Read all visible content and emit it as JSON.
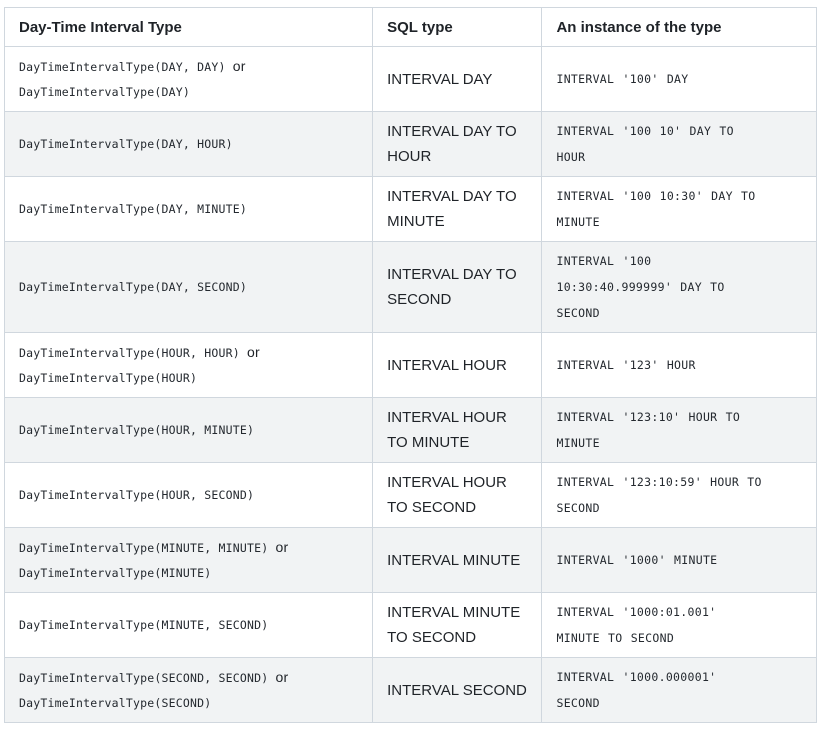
{
  "headers": {
    "col1": "Day-Time Interval Type",
    "col2": "SQL type",
    "col3": "An instance of the type"
  },
  "or_word": "or",
  "rows": [
    {
      "type_lines": [
        "DayTimeIntervalType(DAY, DAY)",
        "DayTimeIntervalType(DAY)"
      ],
      "sql_type_lines": [
        "INTERVAL DAY"
      ],
      "instance_lines": [
        "INTERVAL '100' DAY"
      ]
    },
    {
      "type_lines": [
        "DayTimeIntervalType(DAY, HOUR)"
      ],
      "sql_type_lines": [
        "INTERVAL DAY TO",
        "HOUR"
      ],
      "instance_lines": [
        "INTERVAL '100 10' DAY TO",
        "HOUR"
      ]
    },
    {
      "type_lines": [
        "DayTimeIntervalType(DAY, MINUTE)"
      ],
      "sql_type_lines": [
        "INTERVAL DAY TO",
        "MINUTE"
      ],
      "instance_lines": [
        "INTERVAL '100 10:30' DAY TO",
        "MINUTE"
      ]
    },
    {
      "type_lines": [
        "DayTimeIntervalType(DAY, SECOND)"
      ],
      "sql_type_lines": [
        "INTERVAL DAY TO",
        "SECOND"
      ],
      "instance_lines": [
        "INTERVAL '100",
        "10:30:40.999999' DAY TO",
        "SECOND"
      ]
    },
    {
      "type_lines": [
        "DayTimeIntervalType(HOUR, HOUR)",
        "DayTimeIntervalType(HOUR)"
      ],
      "sql_type_lines": [
        "INTERVAL HOUR"
      ],
      "instance_lines": [
        "INTERVAL '123' HOUR"
      ]
    },
    {
      "type_lines": [
        "DayTimeIntervalType(HOUR, MINUTE)"
      ],
      "sql_type_lines": [
        "INTERVAL HOUR",
        "TO MINUTE"
      ],
      "instance_lines": [
        "INTERVAL '123:10' HOUR TO",
        "MINUTE"
      ]
    },
    {
      "type_lines": [
        "DayTimeIntervalType(HOUR, SECOND)"
      ],
      "sql_type_lines": [
        "INTERVAL HOUR",
        "TO SECOND"
      ],
      "instance_lines": [
        "INTERVAL '123:10:59' HOUR TO",
        "SECOND"
      ]
    },
    {
      "type_lines": [
        "DayTimeIntervalType(MINUTE, MINUTE)",
        "DayTimeIntervalType(MINUTE)"
      ],
      "sql_type_lines": [
        "INTERVAL MINUTE"
      ],
      "instance_lines": [
        "INTERVAL '1000' MINUTE"
      ]
    },
    {
      "type_lines": [
        "DayTimeIntervalType(MINUTE, SECOND)"
      ],
      "sql_type_lines": [
        "INTERVAL MINUTE",
        "TO SECOND"
      ],
      "instance_lines": [
        "INTERVAL '1000:01.001'",
        "MINUTE TO SECOND"
      ]
    },
    {
      "type_lines": [
        "DayTimeIntervalType(SECOND, SECOND)",
        "DayTimeIntervalType(SECOND)"
      ],
      "sql_type_lines": [
        "INTERVAL SECOND"
      ],
      "instance_lines": [
        "INTERVAL '1000.000001'",
        "SECOND"
      ]
    }
  ]
}
